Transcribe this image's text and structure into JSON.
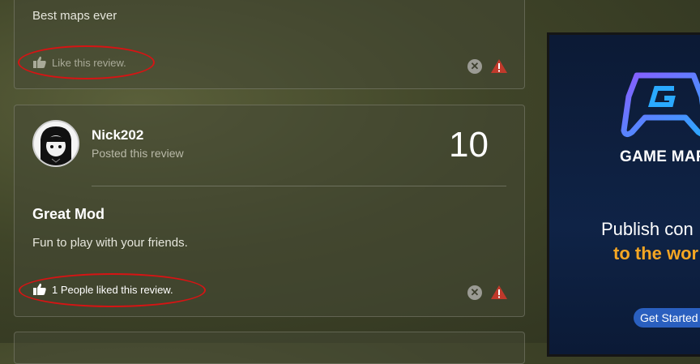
{
  "reviews": [
    {
      "body": "Best maps ever",
      "like_text": "Like this review."
    },
    {
      "username": "Nick202",
      "posted": "Posted this review",
      "score": "10",
      "title": "Great Mod",
      "body": "Fun to play with your friends.",
      "like_text": "1 People liked this review."
    }
  ],
  "ad": {
    "brand": "GAME MAPS",
    "headline": "Publish con",
    "subheadline": "to the wor",
    "cta": "Get Started"
  },
  "colors": {
    "annotation": "#d61414",
    "warning": "#c0392b",
    "ad_accent": "#f5a623"
  },
  "icons": [
    "thumbs-up-icon",
    "close-circle-icon",
    "warning-icon",
    "game-maps-logo-icon"
  ]
}
